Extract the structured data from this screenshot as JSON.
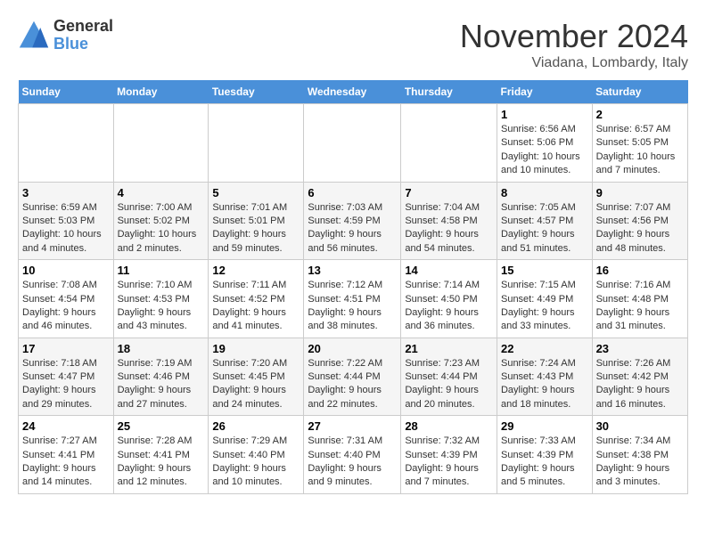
{
  "logo": {
    "general": "General",
    "blue": "Blue"
  },
  "header": {
    "month": "November 2024",
    "location": "Viadana, Lombardy, Italy"
  },
  "weekdays": [
    "Sunday",
    "Monday",
    "Tuesday",
    "Wednesday",
    "Thursday",
    "Friday",
    "Saturday"
  ],
  "weeks": [
    [
      {
        "day": "",
        "info": ""
      },
      {
        "day": "",
        "info": ""
      },
      {
        "day": "",
        "info": ""
      },
      {
        "day": "",
        "info": ""
      },
      {
        "day": "",
        "info": ""
      },
      {
        "day": "1",
        "info": "Sunrise: 6:56 AM\nSunset: 5:06 PM\nDaylight: 10 hours and 10 minutes."
      },
      {
        "day": "2",
        "info": "Sunrise: 6:57 AM\nSunset: 5:05 PM\nDaylight: 10 hours and 7 minutes."
      }
    ],
    [
      {
        "day": "3",
        "info": "Sunrise: 6:59 AM\nSunset: 5:03 PM\nDaylight: 10 hours and 4 minutes."
      },
      {
        "day": "4",
        "info": "Sunrise: 7:00 AM\nSunset: 5:02 PM\nDaylight: 10 hours and 2 minutes."
      },
      {
        "day": "5",
        "info": "Sunrise: 7:01 AM\nSunset: 5:01 PM\nDaylight: 9 hours and 59 minutes."
      },
      {
        "day": "6",
        "info": "Sunrise: 7:03 AM\nSunset: 4:59 PM\nDaylight: 9 hours and 56 minutes."
      },
      {
        "day": "7",
        "info": "Sunrise: 7:04 AM\nSunset: 4:58 PM\nDaylight: 9 hours and 54 minutes."
      },
      {
        "day": "8",
        "info": "Sunrise: 7:05 AM\nSunset: 4:57 PM\nDaylight: 9 hours and 51 minutes."
      },
      {
        "day": "9",
        "info": "Sunrise: 7:07 AM\nSunset: 4:56 PM\nDaylight: 9 hours and 48 minutes."
      }
    ],
    [
      {
        "day": "10",
        "info": "Sunrise: 7:08 AM\nSunset: 4:54 PM\nDaylight: 9 hours and 46 minutes."
      },
      {
        "day": "11",
        "info": "Sunrise: 7:10 AM\nSunset: 4:53 PM\nDaylight: 9 hours and 43 minutes."
      },
      {
        "day": "12",
        "info": "Sunrise: 7:11 AM\nSunset: 4:52 PM\nDaylight: 9 hours and 41 minutes."
      },
      {
        "day": "13",
        "info": "Sunrise: 7:12 AM\nSunset: 4:51 PM\nDaylight: 9 hours and 38 minutes."
      },
      {
        "day": "14",
        "info": "Sunrise: 7:14 AM\nSunset: 4:50 PM\nDaylight: 9 hours and 36 minutes."
      },
      {
        "day": "15",
        "info": "Sunrise: 7:15 AM\nSunset: 4:49 PM\nDaylight: 9 hours and 33 minutes."
      },
      {
        "day": "16",
        "info": "Sunrise: 7:16 AM\nSunset: 4:48 PM\nDaylight: 9 hours and 31 minutes."
      }
    ],
    [
      {
        "day": "17",
        "info": "Sunrise: 7:18 AM\nSunset: 4:47 PM\nDaylight: 9 hours and 29 minutes."
      },
      {
        "day": "18",
        "info": "Sunrise: 7:19 AM\nSunset: 4:46 PM\nDaylight: 9 hours and 27 minutes."
      },
      {
        "day": "19",
        "info": "Sunrise: 7:20 AM\nSunset: 4:45 PM\nDaylight: 9 hours and 24 minutes."
      },
      {
        "day": "20",
        "info": "Sunrise: 7:22 AM\nSunset: 4:44 PM\nDaylight: 9 hours and 22 minutes."
      },
      {
        "day": "21",
        "info": "Sunrise: 7:23 AM\nSunset: 4:44 PM\nDaylight: 9 hours and 20 minutes."
      },
      {
        "day": "22",
        "info": "Sunrise: 7:24 AM\nSunset: 4:43 PM\nDaylight: 9 hours and 18 minutes."
      },
      {
        "day": "23",
        "info": "Sunrise: 7:26 AM\nSunset: 4:42 PM\nDaylight: 9 hours and 16 minutes."
      }
    ],
    [
      {
        "day": "24",
        "info": "Sunrise: 7:27 AM\nSunset: 4:41 PM\nDaylight: 9 hours and 14 minutes."
      },
      {
        "day": "25",
        "info": "Sunrise: 7:28 AM\nSunset: 4:41 PM\nDaylight: 9 hours and 12 minutes."
      },
      {
        "day": "26",
        "info": "Sunrise: 7:29 AM\nSunset: 4:40 PM\nDaylight: 9 hours and 10 minutes."
      },
      {
        "day": "27",
        "info": "Sunrise: 7:31 AM\nSunset: 4:40 PM\nDaylight: 9 hours and 9 minutes."
      },
      {
        "day": "28",
        "info": "Sunrise: 7:32 AM\nSunset: 4:39 PM\nDaylight: 9 hours and 7 minutes."
      },
      {
        "day": "29",
        "info": "Sunrise: 7:33 AM\nSunset: 4:39 PM\nDaylight: 9 hours and 5 minutes."
      },
      {
        "day": "30",
        "info": "Sunrise: 7:34 AM\nSunset: 4:38 PM\nDaylight: 9 hours and 3 minutes."
      }
    ]
  ]
}
